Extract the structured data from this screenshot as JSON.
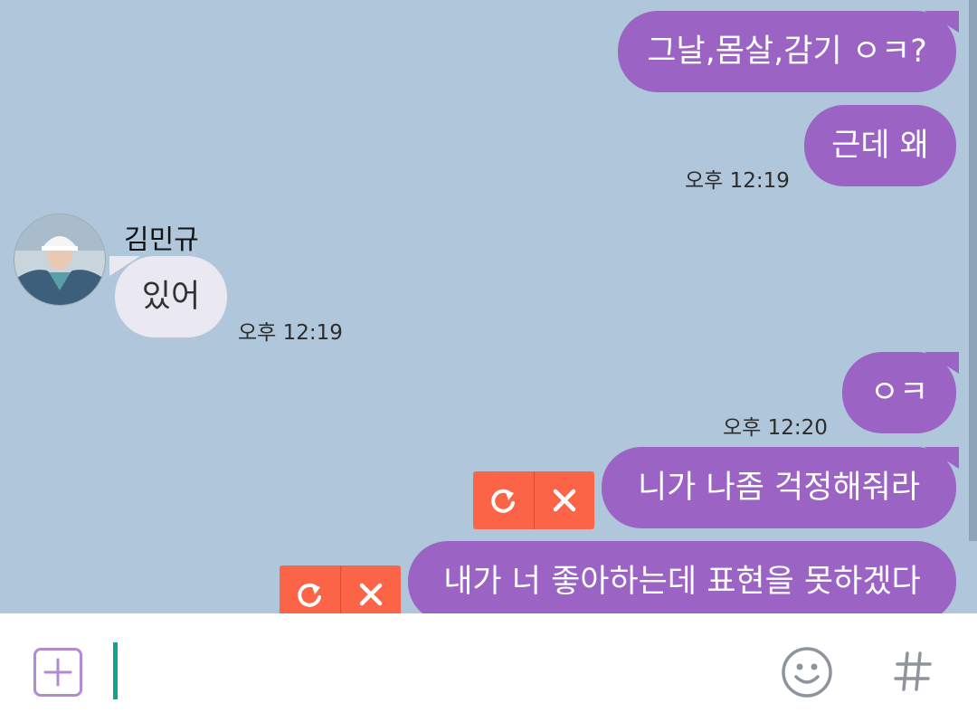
{
  "colors": {
    "background": "#b0c6da",
    "outgoing_bubble": "#9a63c4",
    "incoming_bubble": "#eae8f0",
    "failed_badge": "#fb6446",
    "input_caret": "#12a38f",
    "plus_button": "#b389d4"
  },
  "contact": {
    "name": "김민규"
  },
  "messages": [
    {
      "text": "그날,몸살,감기 ㅇㅋ?",
      "time": ""
    },
    {
      "text": "근데 왜",
      "time": "오후 12:19"
    },
    {
      "text": "있어",
      "time": "오후 12:19"
    },
    {
      "text": "ㅇㅋ",
      "time": "오후 12:20"
    },
    {
      "text": "니가 나좀 걱정해줘라",
      "status": "failed"
    },
    {
      "text": "내가 너 좋아하는데 표현을 못하겠다",
      "status": "failed"
    }
  ],
  "failed_actions": {
    "retry_icon": "retry-icon",
    "delete_icon": "close-icon"
  },
  "input": {
    "value": "",
    "placeholder": ""
  },
  "toolbar": {
    "plus_icon": "plus-icon",
    "emoji_icon": "emoji-icon",
    "hash_icon": "hash-icon"
  }
}
